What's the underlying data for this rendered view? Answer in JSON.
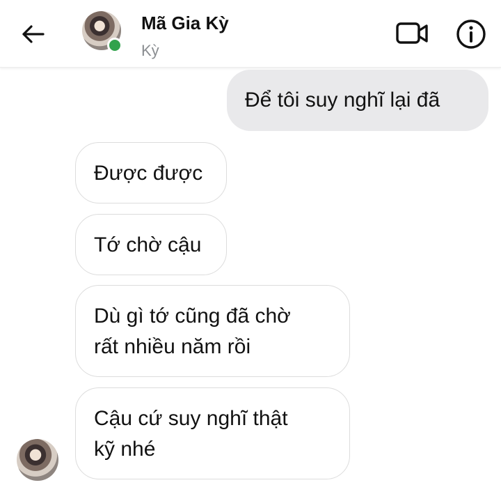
{
  "header": {
    "name": "Mã Gia Kỳ",
    "subtitle": "Kỳ",
    "online": true,
    "icons": {
      "back": "back-arrow-icon",
      "video": "video-call-icon",
      "info": "info-icon"
    }
  },
  "messages": [
    {
      "direction": "outgoing",
      "lines": [
        "Để tôi suy nghĩ lại đã"
      ]
    },
    {
      "direction": "incoming",
      "lines": [
        "Được được"
      ]
    },
    {
      "direction": "incoming",
      "lines": [
        "Tớ chờ cậu"
      ]
    },
    {
      "direction": "incoming",
      "lines": [
        "Dù gì tớ cũng đã chờ",
        "rất nhiều năm rồi"
      ]
    },
    {
      "direction": "incoming",
      "lines": [
        "Cậu cứ suy nghĩ thật",
        "kỹ nhé"
      ]
    }
  ],
  "colors": {
    "outgoing_bubble": "#e9e9eb",
    "incoming_border": "#dcdcdc",
    "online": "#31a24c",
    "subtitle": "#8a8d91"
  }
}
